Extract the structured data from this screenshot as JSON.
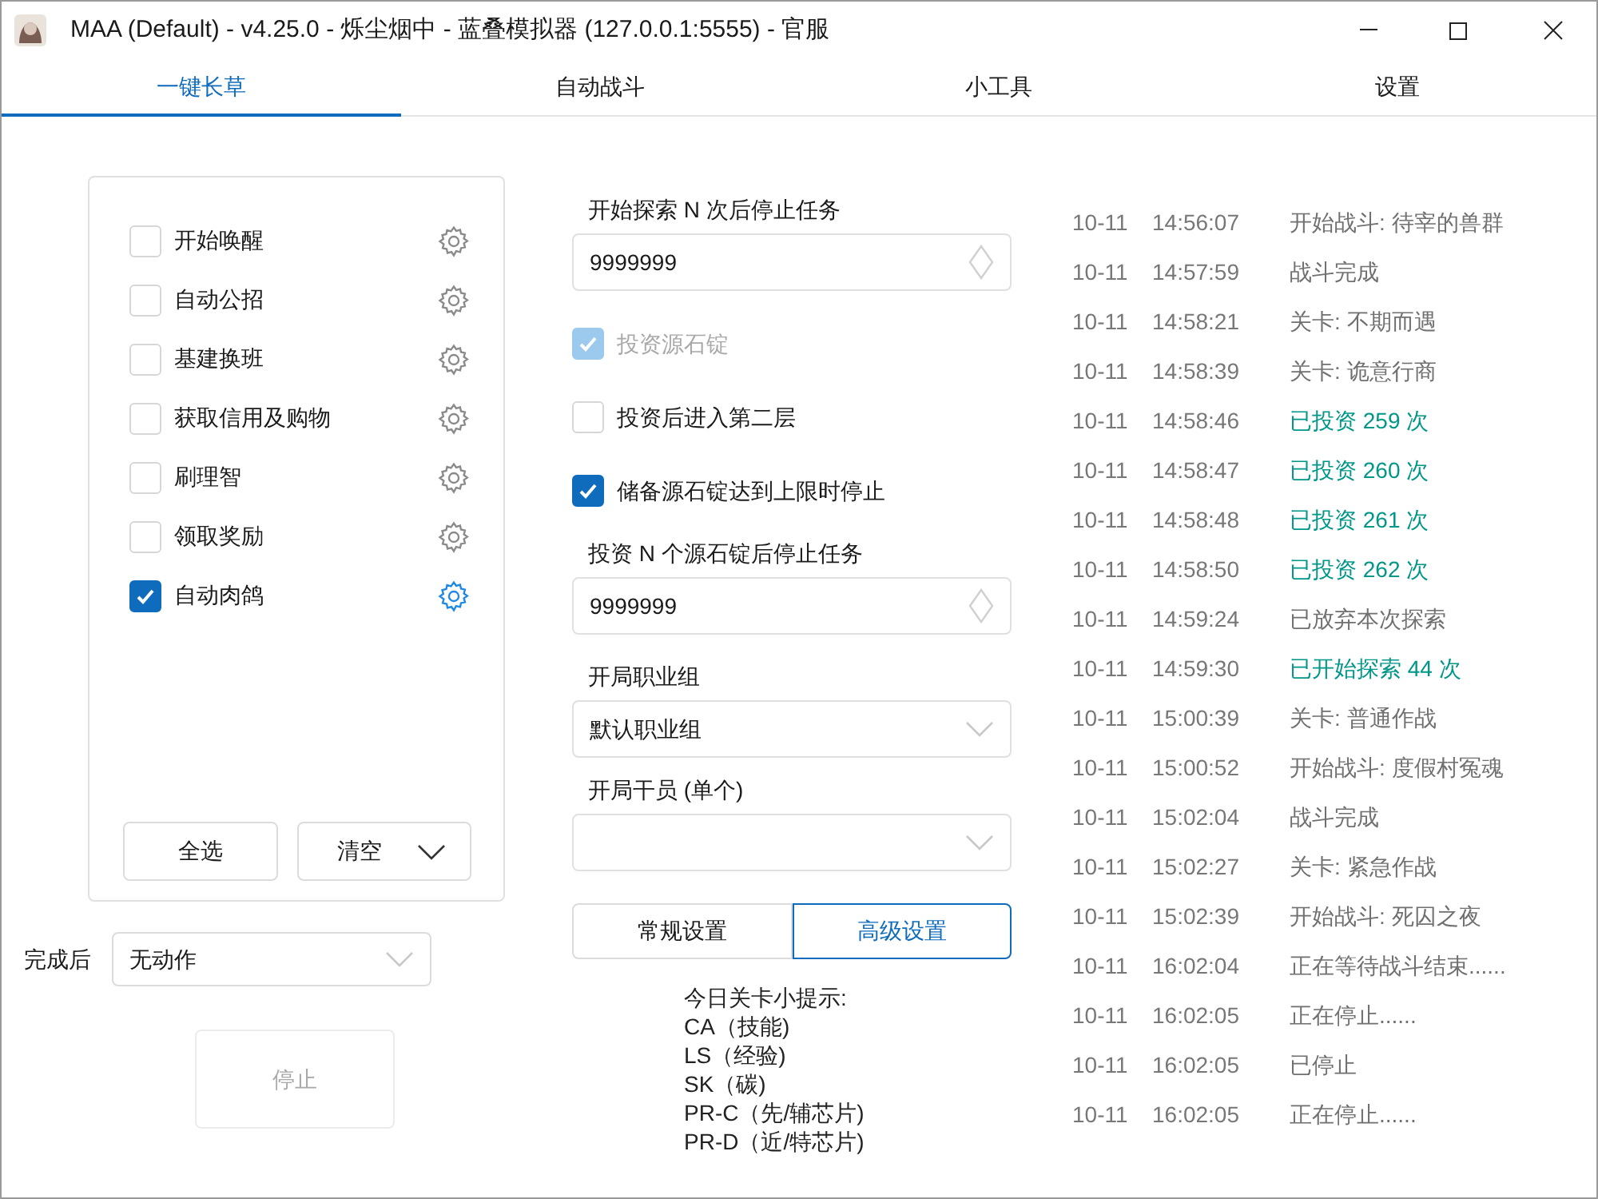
{
  "window": {
    "title": "MAA (Default) - v4.25.0 - 烁尘烟中 - 蓝叠模拟器 (127.0.0.1:5555) - 官服"
  },
  "tabs": [
    {
      "label": "一键长草",
      "selected": true
    },
    {
      "label": "自动战斗",
      "selected": false
    },
    {
      "label": "小工具",
      "selected": false
    },
    {
      "label": "设置",
      "selected": false
    }
  ],
  "tasks": [
    {
      "label": "开始唤醒",
      "checked": false
    },
    {
      "label": "自动公招",
      "checked": false
    },
    {
      "label": "基建换班",
      "checked": false
    },
    {
      "label": "获取信用及购物",
      "checked": false
    },
    {
      "label": "刷理智",
      "checked": false
    },
    {
      "label": "领取奖励",
      "checked": false
    },
    {
      "label": "自动肉鸽",
      "checked": true
    }
  ],
  "task_buttons": {
    "select_all": "全选",
    "clear": "清空"
  },
  "after_completion": {
    "label": "完成后",
    "value": "无动作"
  },
  "stop_button": {
    "label": "停止",
    "disabled": true
  },
  "settings": [
    {
      "kind": "label",
      "text": "开始探索 N 次后停止任务"
    },
    {
      "kind": "number",
      "value": "9999999"
    },
    {
      "kind": "checkbox",
      "label": "投资源石锭",
      "checked": true,
      "disabled": true
    },
    {
      "kind": "checkbox",
      "label": "投资后进入第二层",
      "checked": false,
      "disabled": false
    },
    {
      "kind": "checkbox",
      "label": "储备源石锭达到上限时停止",
      "checked": true,
      "disabled": false
    },
    {
      "kind": "label",
      "text": "投资 N 个源石锭后停止任务"
    },
    {
      "kind": "number",
      "value": "9999999"
    },
    {
      "kind": "label",
      "text": "开局职业组"
    },
    {
      "kind": "select",
      "value": "默认职业组"
    },
    {
      "kind": "label",
      "text": "开局干员 (单个)"
    },
    {
      "kind": "select"
    }
  ],
  "settings_tabs": [
    {
      "label": "常规设置",
      "selected": false
    },
    {
      "label": "高级设置",
      "selected": true
    }
  ],
  "tips": [
    "今日关卡小提示:",
    "CA（技能)",
    "LS（经验)",
    "SK（碳)",
    "PR-C（先/辅芯片)",
    "PR-D（近/特芯片)"
  ],
  "log": [
    {
      "date": "10-11",
      "time": "14:56:07",
      "message": "开始战斗: 待宰的兽群",
      "color": "#707070"
    },
    {
      "date": "10-11",
      "time": "14:57:59",
      "message": "战斗完成",
      "color": "#707070"
    },
    {
      "date": "10-11",
      "time": "14:58:21",
      "message": "关卡: 不期而遇",
      "color": "#707070"
    },
    {
      "date": "10-11",
      "time": "14:58:39",
      "message": "关卡: 诡意行商",
      "color": "#707070"
    },
    {
      "date": "10-11",
      "time": "14:58:46",
      "message": "已投资 259 次",
      "color": "#009688"
    },
    {
      "date": "10-11",
      "time": "14:58:47",
      "message": "已投资 260 次",
      "color": "#009688"
    },
    {
      "date": "10-11",
      "time": "14:58:48",
      "message": "已投资 261 次",
      "color": "#009688"
    },
    {
      "date": "10-11",
      "time": "14:58:50",
      "message": "已投资 262 次",
      "color": "#009688"
    },
    {
      "date": "10-11",
      "time": "14:59:24",
      "message": "已放弃本次探索",
      "color": "#707070"
    },
    {
      "date": "10-11",
      "time": "14:59:30",
      "message": "已开始探索 44 次",
      "color": "#009688"
    },
    {
      "date": "10-11",
      "time": "15:00:39",
      "message": "关卡: 普通作战",
      "color": "#707070"
    },
    {
      "date": "10-11",
      "time": "15:00:52",
      "message": "开始战斗: 度假村冤魂",
      "color": "#707070"
    },
    {
      "date": "10-11",
      "time": "15:02:04",
      "message": "战斗完成",
      "color": "#707070"
    },
    {
      "date": "10-11",
      "time": "15:02:27",
      "message": "关卡: 紧急作战",
      "color": "#707070"
    },
    {
      "date": "10-11",
      "time": "15:02:39",
      "message": "开始战斗: 死囚之夜",
      "color": "#707070"
    },
    {
      "date": "10-11",
      "time": "16:02:04",
      "message": "正在等待战斗结束......",
      "color": "#707070"
    },
    {
      "date": "10-11",
      "time": "16:02:05",
      "message": "正在停止......",
      "color": "#707070"
    },
    {
      "date": "10-11",
      "time": "16:02:05",
      "message": "已停止",
      "color": "#707070"
    },
    {
      "date": "10-11",
      "time": "16:02:05",
      "message": "正在停止......",
      "color": "#707070"
    }
  ]
}
